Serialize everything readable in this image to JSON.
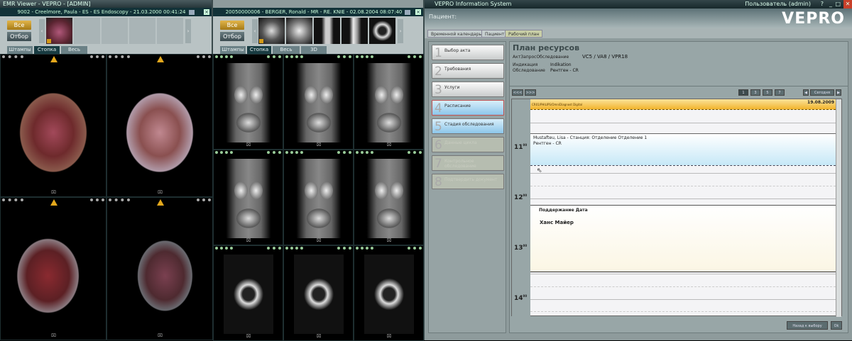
{
  "viewer_left": {
    "title": "EMR Viewer - VEPRO - [ADMIN]",
    "header": "9002 - Creelmore, Paula - ES - ES Endoscopy - 21.03.2000 00:41:24",
    "all_label": "Все",
    "select_label": "Отбор",
    "tabs": [
      "Штампы",
      "Стопка",
      "Весь отбор"
    ],
    "thumb_count": 1
  },
  "viewer_mid": {
    "header": "20050000006 - BERGER, Ronald - MR - RE. KNIE - 02.08.2004 08:07:40",
    "all_label": "Все",
    "select_label": "Отбор",
    "tabs": [
      "Штампы",
      "Стопка",
      "Весь отбор",
      "3D"
    ]
  },
  "app": {
    "title": "VEPRO Information System",
    "user": "Пользователь (admin)",
    "window_controls": [
      "?",
      "_",
      "□",
      "✕"
    ],
    "patient_label": "Пациент:",
    "logo": "VEPRO",
    "tabs": [
      "Временной календарь",
      "Пациент",
      "Рабочий план"
    ],
    "active_tab": 2,
    "steps": [
      {
        "num": "1",
        "label": "Выбор акта",
        "state": "done"
      },
      {
        "num": "2",
        "label": "Требования",
        "state": "done"
      },
      {
        "num": "3",
        "label": "Услуги",
        "state": "done"
      },
      {
        "num": "4",
        "label": "Расписание",
        "state": "active"
      },
      {
        "num": "5",
        "label": "Стадия обследования",
        "state": "next"
      },
      {
        "num": "6",
        "label": "Данные цикла",
        "state": "disabled"
      },
      {
        "num": "7",
        "label": "Контрольное обследование",
        "state": "disabled"
      },
      {
        "num": "8",
        "label": "Подтвердить документ",
        "state": "disabled"
      }
    ],
    "plan": {
      "title": "План ресурсов",
      "act_label": "АктЗапросОбследование",
      "act_value": "VC5 / VA8 / VPR18",
      "indication_label": "Индикация",
      "indication_value": "Indikation",
      "exam_label": "Обследование",
      "exam_value": "Рентген - CR"
    },
    "toolbar": {
      "prev_label": "<<<",
      "next_label": ">>>",
      "views": [
        "1",
        "3",
        "5",
        "7"
      ],
      "today_label": "Сегодня"
    },
    "calendar": {
      "resource": "CR01/PHILIPS/OmniDiagnost Digital",
      "date": "19.08.2009",
      "hours": [
        "11",
        "12",
        "13",
        "14"
      ],
      "minutes": "00",
      "events": [
        {
          "title": "Mustafteu, Lisa - Станция: Отделение Отделение 1",
          "subtitle": "Рентген - CR"
        },
        {
          "title": "Поддержание Дата",
          "subtitle": "Ханс Майер"
        }
      ]
    },
    "back_label": "Назад к выбору",
    "ok_label": "Ok"
  }
}
